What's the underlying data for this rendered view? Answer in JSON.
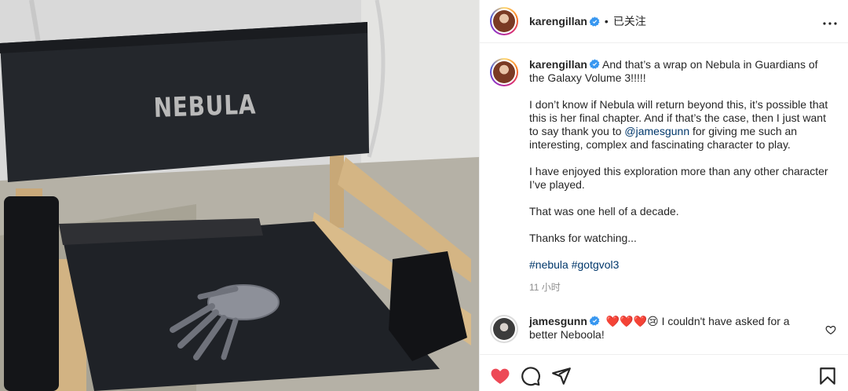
{
  "post": {
    "photo": {
      "chair_label": "NEBULA"
    },
    "header": {
      "username": "karengillan",
      "separator": "•",
      "follow_status": "已关注"
    },
    "caption": {
      "username": "karengillan",
      "line1": "And that’s a wrap on Nebula in Guardians of the Galaxy Volume 3!!!!!",
      "para2_before": "I don’t know if Nebula will return beyond this, it’s possible that this is her final chapter. And if that’s the case, then I just want to say thank you to ",
      "para2_mention": "@jamesgunn",
      "para2_after": " for giving me such an interesting, complex and fascinating character to play.",
      "para3": "I have enjoyed this exploration more than any other character I’ve played.",
      "para4": "That was one hell of a decade.",
      "para5": "Thanks for watching...",
      "hashtag1": "#nebula",
      "hashtag2": "#gotgvol3",
      "timestamp": "11 小时"
    },
    "comment": {
      "username": "jamesgunn",
      "emoji": "❤️❤️❤️😢",
      "text": " I couldn't have asked for a better Neboola!"
    },
    "icons": {
      "verified": "verified-badge-icon",
      "more": "more-options-icon",
      "like": "heart-icon",
      "comment": "comment-icon",
      "share": "share-icon",
      "save": "bookmark-icon",
      "comment_like": "heart-outline-icon"
    },
    "colors": {
      "like_red": "#ed4956",
      "verified_blue": "#3897f0",
      "link_blue": "#00376b",
      "muted": "#8e8e8e"
    }
  }
}
